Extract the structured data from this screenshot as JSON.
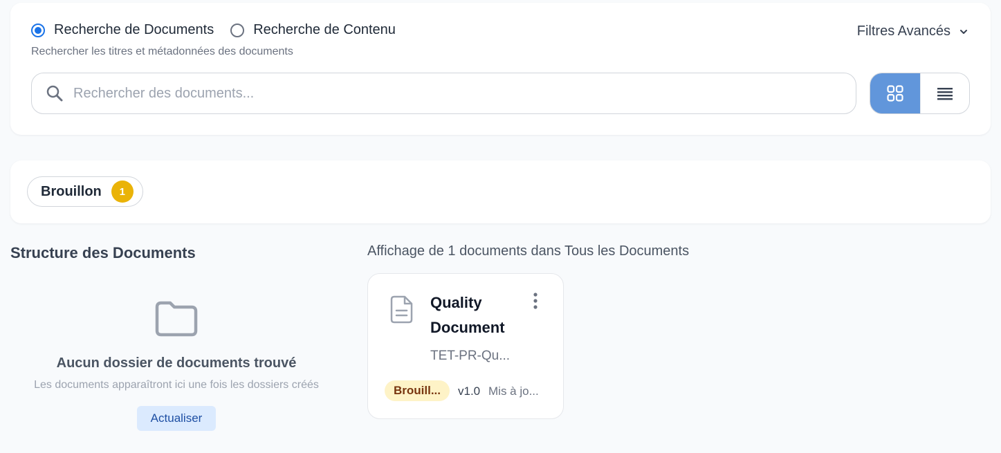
{
  "search": {
    "modes": [
      {
        "label": "Recherche de Documents",
        "selected": true
      },
      {
        "label": "Recherche de Contenu",
        "selected": false
      }
    ],
    "hint": "Rechercher les titres et métadonnées des documents",
    "advanced_filters_label": "Filtres Avancés",
    "placeholder": "Rechercher des documents...",
    "value": "",
    "view_modes": [
      {
        "name": "grid",
        "icon": "grid-icon",
        "active": true
      },
      {
        "name": "list",
        "icon": "list-icon",
        "active": false
      }
    ]
  },
  "status_filters": [
    {
      "label": "Brouillon",
      "count": "1"
    }
  ],
  "structure": {
    "title": "Structure des Documents",
    "empty_icon": "folder-icon",
    "empty_title": "Aucun dossier de documents trouvé",
    "empty_desc": "Les documents apparaîtront ici une fois les dossiers créés",
    "refresh_label": "Actualiser"
  },
  "results": {
    "summary": "Affichage de 1 documents dans Tous les Documents",
    "documents": [
      {
        "title": "Quality Document",
        "code": "TET-PR-Qu...",
        "status": "Brouill...",
        "version": "v1.0",
        "updated": "Mis à jo...",
        "icon": "file-text-icon"
      }
    ]
  },
  "colors": {
    "accent": "#1a73e8",
    "active_view": "#6196db",
    "draft_badge_bg": "#fef3c7",
    "draft_count_bg": "#eab308",
    "refresh_bg": "#dbeafe"
  }
}
